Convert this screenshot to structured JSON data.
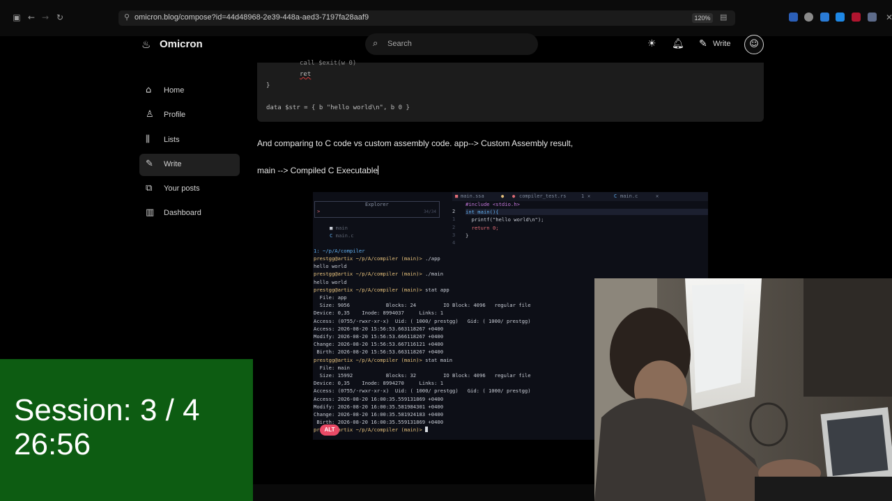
{
  "browser": {
    "url": "omicron.blog/compose?id=44d48968-2e39-448a-aed3-7197fa28aaf9",
    "zoom": "120%",
    "icons": [
      "sidebar-icon",
      "back-icon",
      "forward-icon",
      "reload-icon",
      "lock-icon",
      "reader-icon",
      "extension-icons"
    ]
  },
  "header": {
    "brand": "Omicron",
    "search_placeholder": "Search",
    "write_label": "Write"
  },
  "sidebar": {
    "items": [
      {
        "label": "Home",
        "icon": "home-icon"
      },
      {
        "label": "Profile",
        "icon": "user-icon"
      },
      {
        "label": "Lists",
        "icon": "library-icon"
      },
      {
        "label": "Write",
        "icon": "pen-icon",
        "active": true
      },
      {
        "label": "Your posts",
        "icon": "posts-icon"
      },
      {
        "label": "Dashboard",
        "icon": "chart-icon"
      }
    ]
  },
  "editor": {
    "code_lines": [
      "call $exit(w 0)",
      "ret",
      "}",
      "data $str = { b \"hello world\\n\", b 0 }"
    ],
    "paragraph1": "And comparing to C code vs custom assembly code.  app--> Custom Assembly result,",
    "paragraph2": "main --> Compiled C Executable"
  },
  "terminal": {
    "tabs": [
      "main.ssa",
      "compiler_test.rs",
      "main.c"
    ],
    "tab_badge": "1",
    "explorer_title": "Explorer",
    "explorer_prompt": ">",
    "explorer_count": "34/34",
    "files": [
      "main",
      "main.c"
    ],
    "editor_lines": [
      "#include <stdio.h>",
      "int main(){",
      "  printf(\"hello world\\n\");",
      "  return 0;",
      "}"
    ],
    "editor_line_numbers": [
      "2",
      "1",
      "2",
      "3",
      "4"
    ],
    "header_line": "1: ~/p/A/compiler",
    "prompt": "prestgg@artix ~/p/A/compiler (main)>",
    "lines": [
      {
        "p": true,
        "cmd": " ./app"
      },
      {
        "t": "hello world"
      },
      {
        "p": true,
        "cmd": " ./main"
      },
      {
        "t": "hello world"
      },
      {
        "p": true,
        "cmd": " stat app"
      },
      {
        "t": "  File: app"
      },
      {
        "t": "  Size: 9056            Blocks: 24         IO Block: 4096   regular file"
      },
      {
        "t": "Device: 0,35    Inode: 8994037     Links: 1"
      },
      {
        "t": "Access: (0755/-rwxr-xr-x)  Uid: ( 1000/ prestgg)   Gid: ( 1000/ prestgg)"
      },
      {
        "t": "Access: 2026-08-20 15:56:53.663118267 +0400"
      },
      {
        "t": "Modify: 2026-08-20 15:56:53.666118267 +0400"
      },
      {
        "t": "Change: 2026-08-20 15:56:53.667116121 +0400"
      },
      {
        "t": " Birth: 2026-08-20 15:56:53.663118267 +0400"
      },
      {
        "p": true,
        "cmd": " stat main"
      },
      {
        "t": "  File: main"
      },
      {
        "t": "  Size: 15992           Blocks: 32         IO Block: 4096   regular file"
      },
      {
        "t": "Device: 0,35    Inode: 8994270     Links: 1"
      },
      {
        "t": "Access: (0755/-rwxr-xr-x)  Uid: ( 1000/ prestgg)   Gid: ( 1000/ prestgg)"
      },
      {
        "t": "Access: 2026-08-20 16:00:35.559131869 +0400"
      },
      {
        "t": "Modify: 2026-08-20 16:00:35.581984301 +0400"
      },
      {
        "t": "Change: 2026-08-20 16:00:35.581924183 +0400"
      },
      {
        "t": " Birth: 2026-08-20 16:00:35.559131869 +0400"
      },
      {
        "p": true,
        "cmd": " "
      }
    ],
    "alt_badge": "ALT"
  },
  "overlay": {
    "session": "Session: 3 / 4",
    "timer": "26:56"
  },
  "colors": {
    "session_bg": "#0d5c12",
    "alt_badge": "#e94a66",
    "prompt": "#e5c07b"
  }
}
